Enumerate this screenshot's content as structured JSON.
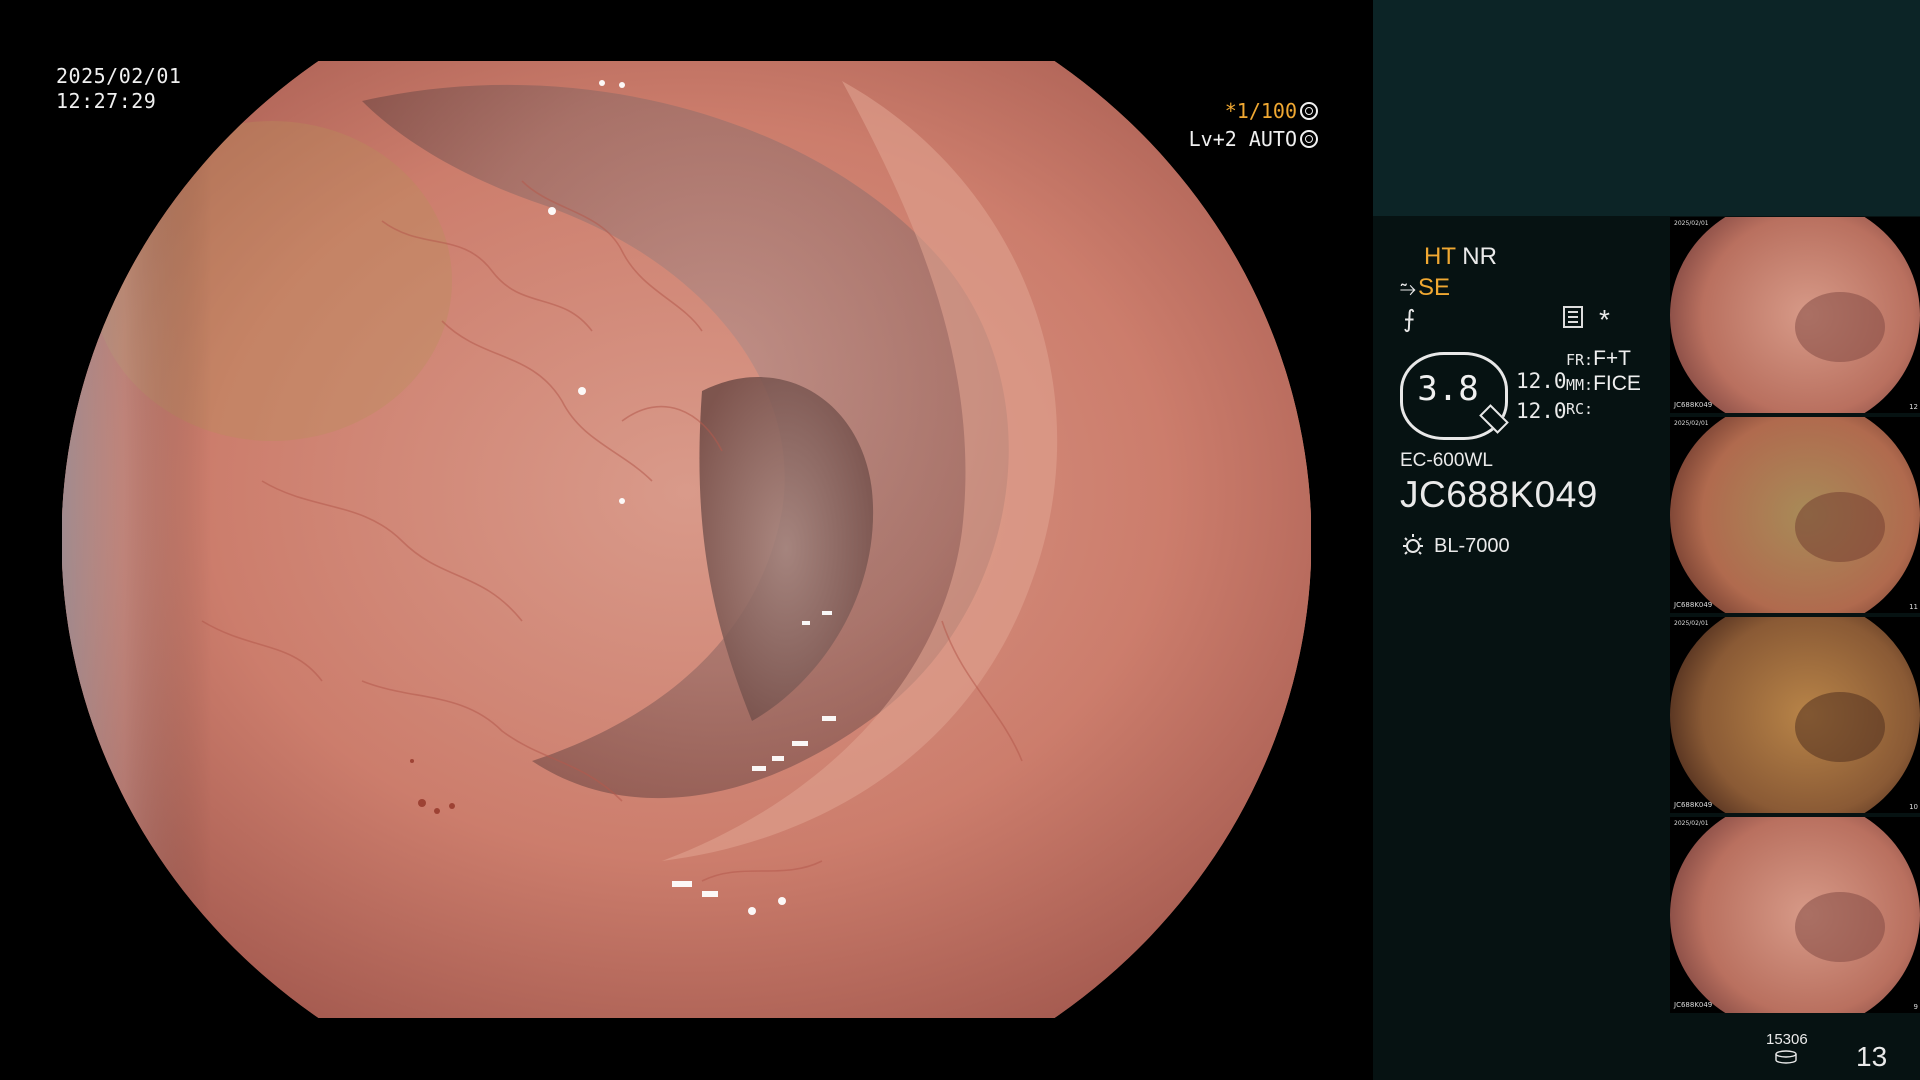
{
  "overlay": {
    "date": "2025/02/01",
    "time": "12:27:29",
    "shutter": "*1/100",
    "level": "Lv+2 AUTO"
  },
  "panel": {
    "ht_label": "HT",
    "nr_label": "NR",
    "se_label": "SE",
    "zoom_value": "3.8",
    "gain_top": "12.0",
    "gain_bottom": "12.0",
    "fr_label": "FR:",
    "fr_value": "F+T",
    "mm_label": "MM:",
    "mm_value": "FICE",
    "rc_label": "RC:",
    "scope_model": "EC-600WL",
    "scope_serial": "JC688K049",
    "light_source": "BL-7000"
  },
  "thumbnails": [
    {
      "serial": "JC688K049",
      "number": "12",
      "palette": "pink"
    },
    {
      "serial": "JC688K049",
      "number": "11",
      "palette": "yellow"
    },
    {
      "serial": "JC688K049",
      "number": "10",
      "palette": "amber"
    },
    {
      "serial": "JC688K049",
      "number": "9",
      "palette": "pink"
    }
  ],
  "footer": {
    "disk_count": "15306",
    "frame_number": "13"
  },
  "colors": {
    "accent_amber": "#f0a832",
    "panel_background": "#061212",
    "panel_top_block": "#0c2426"
  }
}
